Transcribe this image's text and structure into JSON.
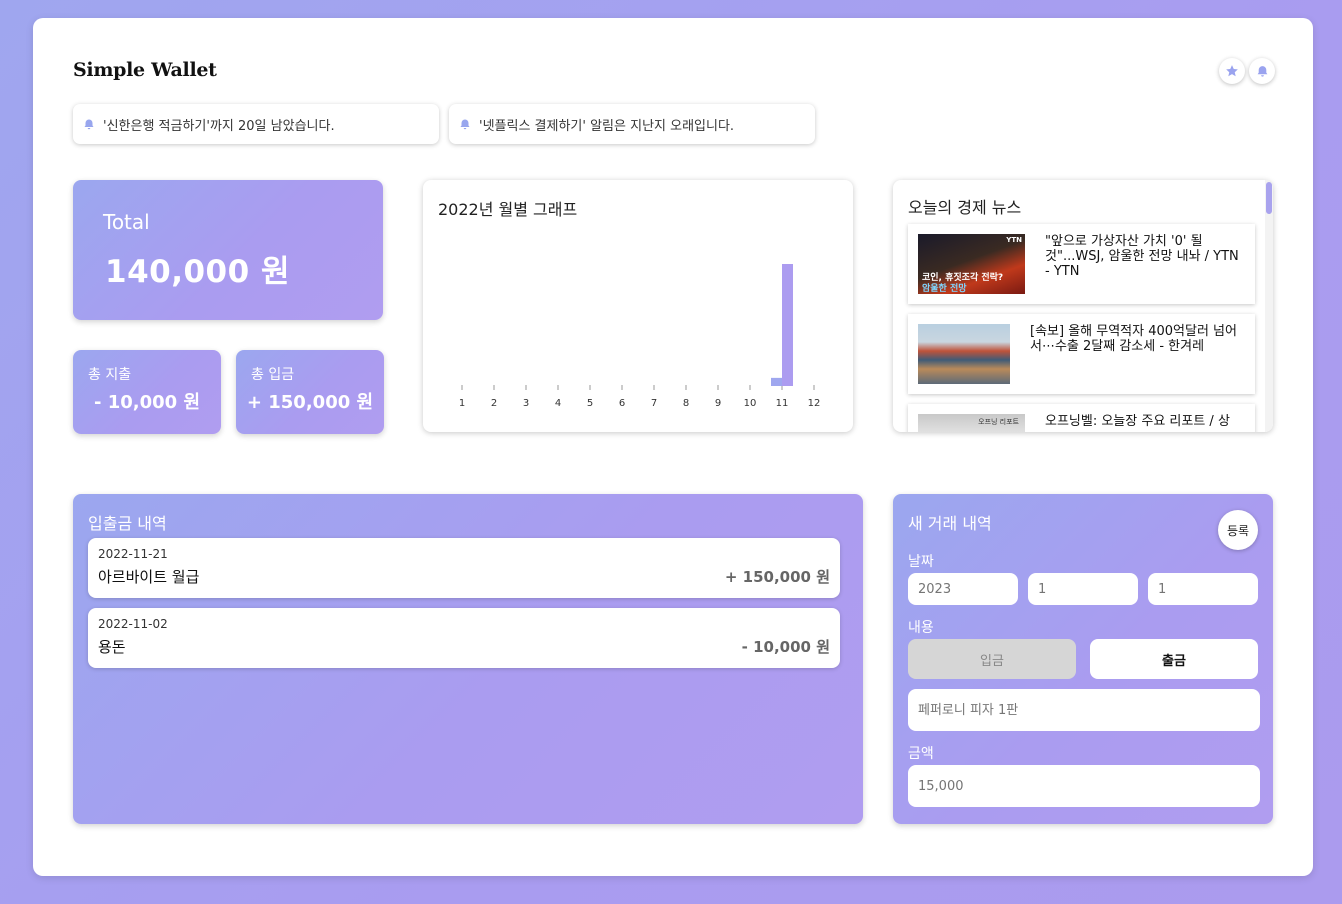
{
  "app": {
    "title": "Simple Wallet"
  },
  "header": {
    "icons": [
      "star-icon",
      "bell-icon"
    ]
  },
  "notifications": [
    {
      "icon": "bell-icon",
      "text": "'신한은행 적금하기'까지 20일 남았습니다."
    },
    {
      "icon": "bell-icon",
      "text": "'넷플릭스 결제하기' 알림은 지난지 오래입니다."
    }
  ],
  "summary": {
    "total_label": "Total",
    "total_value": "140,000 원",
    "expense_label": "총 지출",
    "expense_value": "- 10,000 원",
    "income_label": "총 입금",
    "income_value": "+ 150,000 원"
  },
  "chart": {
    "title": "2022년 월별 그래프",
    "colors": {
      "income": "#ac9cf0",
      "expense": "#9fa7ef"
    }
  },
  "chart_data": {
    "type": "bar",
    "title": "2022년 월별 그래프",
    "categories": [
      "1",
      "2",
      "3",
      "4",
      "5",
      "6",
      "7",
      "8",
      "9",
      "10",
      "11",
      "12"
    ],
    "series": [
      {
        "values": [
          0,
          0,
          0,
          0,
          0,
          0,
          0,
          0,
          0,
          0,
          10000,
          0
        ]
      },
      {
        "values": [
          0,
          0,
          0,
          0,
          0,
          0,
          0,
          0,
          0,
          0,
          150000,
          0
        ]
      }
    ],
    "ylim": [
      0,
      150000
    ],
    "grid": false
  },
  "news": {
    "title": "오늘의 경제 뉴스",
    "items": [
      {
        "thumb_badge": "YTN",
        "thumb_caption_1": "코인, 휴짓조각 전락?",
        "thumb_caption_2": "암울한 전망",
        "text": "\"앞으로 가상자산 가치 '0' 될 것\"...WSJ, 암울한 전망 내놔 / YTN - YTN"
      },
      {
        "text": "[속보] 올해 무역적자 400억달러 넘어서⋯수출 2달째 감소세 - 한겨레"
      },
      {
        "thumb_caption": "오프닝 리포트",
        "text": "오프닝벨: 오늘장 주요 리포트 / 상"
      }
    ]
  },
  "history": {
    "title": "입출금 내역",
    "rows": [
      {
        "date": "2022-11-21",
        "desc": "아르바이트 월급",
        "amount": "+ 150,000 원"
      },
      {
        "date": "2022-11-02",
        "desc": "용돈",
        "amount": "- 10,000 원"
      }
    ]
  },
  "new_tx": {
    "title": "새 거래 내역",
    "register_label": "등록",
    "date_label": "날짜",
    "year": "2023",
    "month": "1",
    "day": "1",
    "content_label": "내용",
    "income_btn": "입금",
    "expense_btn": "출금",
    "content_placeholder": "페퍼로니 피자 1판",
    "amount_label": "금액",
    "amount_placeholder": "15,000"
  }
}
